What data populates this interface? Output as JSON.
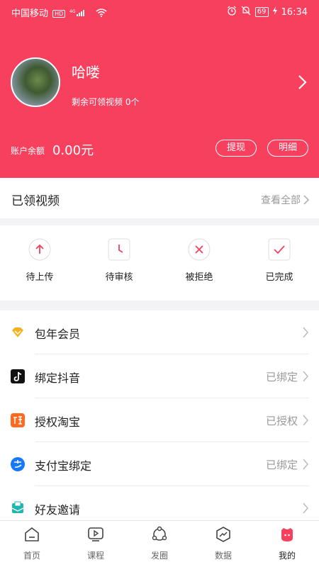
{
  "status_bar": {
    "carrier": "中国移动",
    "hd": "HD",
    "network": "4G",
    "battery": "69",
    "time": "16:34"
  },
  "profile": {
    "username": "哈喽",
    "remaining_videos": "剩余可领视频 0个",
    "balance_label": "账户余额",
    "balance": "0.00元",
    "withdraw_label": "提现",
    "detail_label": "明细"
  },
  "claimed": {
    "title": "已领视频",
    "view_all": "查看全部",
    "statuses": [
      {
        "label": "待上传",
        "icon": "upload-icon"
      },
      {
        "label": "待审核",
        "icon": "clock-icon"
      },
      {
        "label": "被拒绝",
        "icon": "reject-icon"
      },
      {
        "label": "已完成",
        "icon": "check-icon"
      }
    ]
  },
  "menu": [
    {
      "label": "包年会员",
      "value": "",
      "icon": "vip-diamond-icon"
    },
    {
      "label": "绑定抖音",
      "value": "已绑定",
      "icon": "douyin-icon"
    },
    {
      "label": "授权淘宝",
      "value": "已授权",
      "icon": "taobao-icon"
    },
    {
      "label": "支付宝绑定",
      "value": "已绑定",
      "icon": "alipay-icon"
    },
    {
      "label": "好友邀请",
      "value": "",
      "icon": "invite-icon"
    }
  ],
  "tabs": [
    {
      "label": "首页",
      "icon": "home-icon"
    },
    {
      "label": "课程",
      "icon": "course-icon"
    },
    {
      "label": "发圈",
      "icon": "moments-icon"
    },
    {
      "label": "数据",
      "icon": "data-icon"
    },
    {
      "label": "我的",
      "icon": "mine-icon"
    }
  ],
  "colors": {
    "brand": "#f6405e",
    "accent_gold": "#f5b21e",
    "taobao": "#ff6a1e",
    "alipay": "#1677ff",
    "invite": "#1fb6b0"
  }
}
